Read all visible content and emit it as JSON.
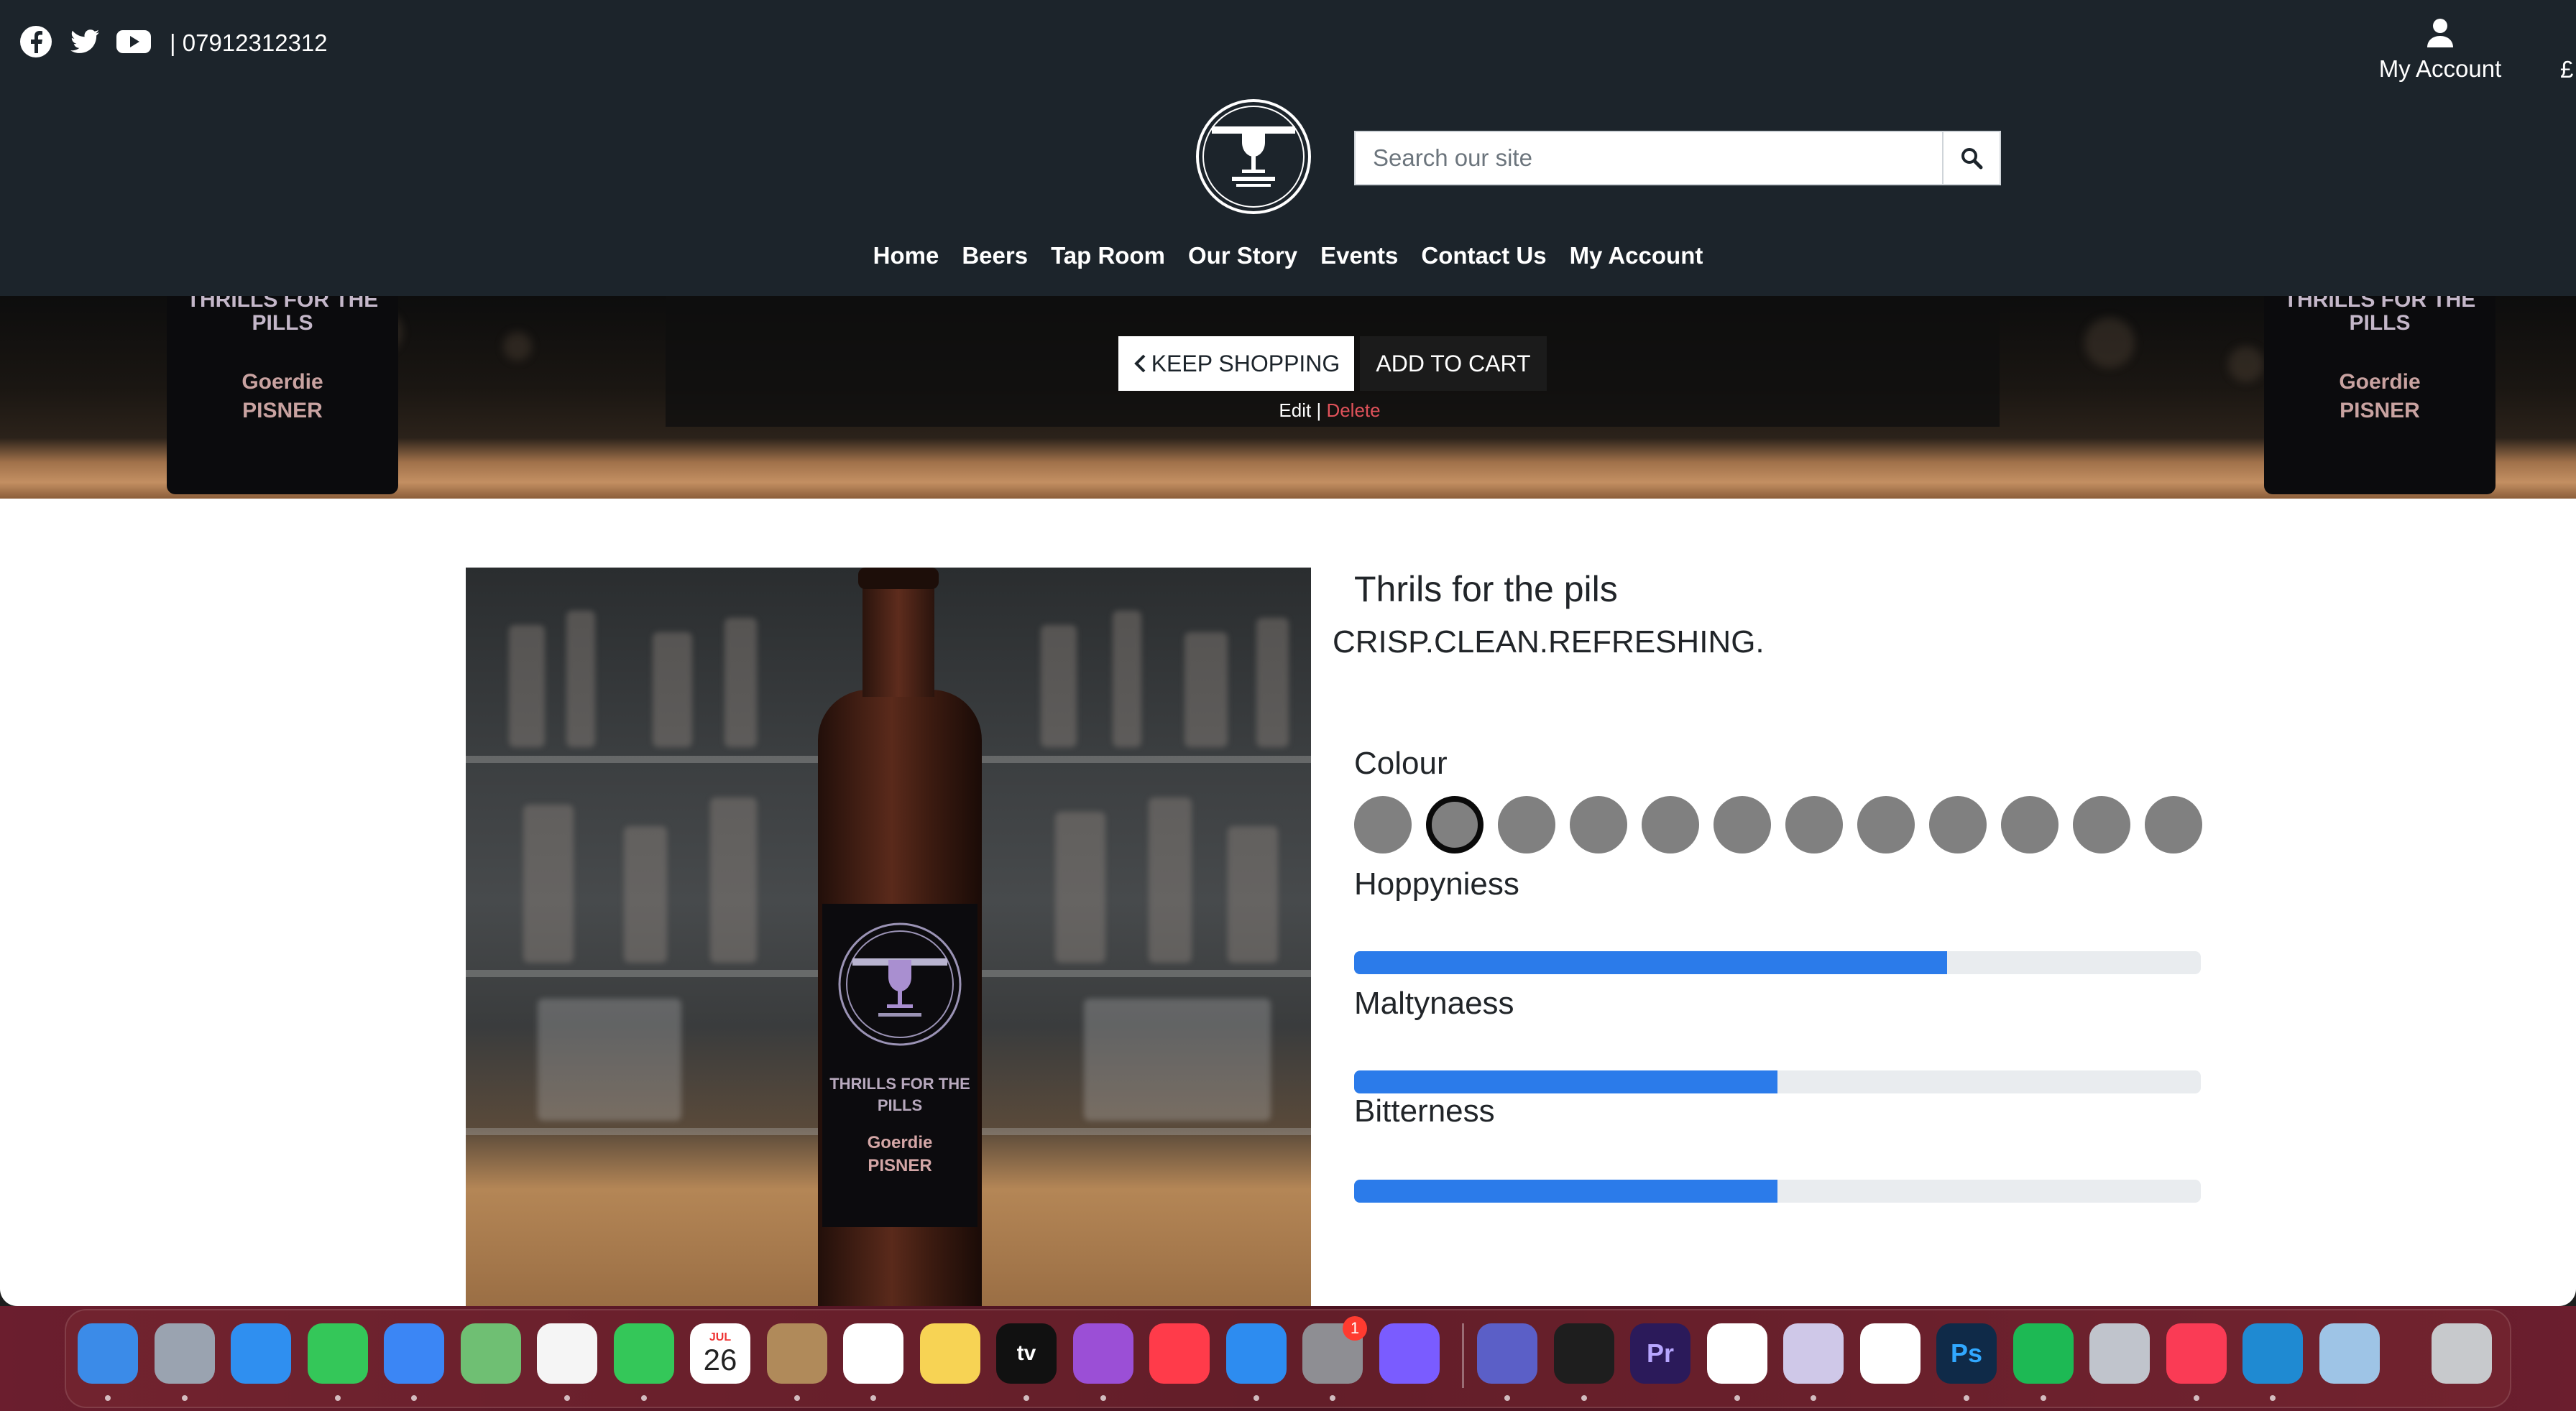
{
  "header": {
    "phone": "| 07912312312",
    "account_label": "My Account",
    "currency": "£",
    "search_placeholder": "Search our site",
    "nav": [
      "Home",
      "Beers",
      "Tap Room",
      "Our Story",
      "Events",
      "Contact Us",
      "My Account"
    ]
  },
  "hero": {
    "keep_shopping": "KEEP SHOPPING",
    "add_to_cart": "ADD TO CART",
    "edit": "Edit",
    "separator": "|",
    "delete": "Delete",
    "bottle_line1": "THRILLS FOR THE",
    "bottle_line2": "PILLS",
    "bottle_line3": "Goerdie",
    "bottle_line4": "PISNER"
  },
  "product": {
    "title": "Thrils for the pils",
    "tagline": "CRISP.CLEAN.REFRESHING.",
    "image_label_line1": "THRILLS FOR THE",
    "image_label_line2": "PILLS",
    "image_label_line3": "Goerdie",
    "image_label_line4": "PISNER",
    "colour_label": "Colour",
    "colour_options": 12,
    "colour_selected_index": 1,
    "hoppyniess_label": "Hoppyniess",
    "hoppyniess_level": 0.7,
    "maltynaess_label": "Maltynaess",
    "maltynaess_level": 0.5,
    "bitterness_label": "Bitterness",
    "bitterness_level": 0.5
  },
  "colors": {
    "header_bg": "#1c242b",
    "progress_fill": "#2b7bea",
    "delete_link": "#e0525a",
    "swatch": "#808080"
  },
  "dock": {
    "apps": [
      "finder",
      "launchpad",
      "safari",
      "messages",
      "mail",
      "maps",
      "photos",
      "facetime",
      "calendar",
      "contacts",
      "reminders",
      "notes",
      "apple-tv",
      "podcasts",
      "news",
      "app-store",
      "system-preferences",
      "messenger",
      "teams",
      "terminal",
      "premiere-pro",
      "chrome",
      "vpn",
      "smile",
      "photoshop",
      "spotify",
      "rocket",
      "music",
      "vscode",
      "preview",
      "trash"
    ],
    "calendar_month": "JUL",
    "calendar_day": "26",
    "badge_count": "1",
    "apple_tv_label": "tv",
    "premiere_label": "Pr",
    "photoshop_label": "Ps"
  }
}
